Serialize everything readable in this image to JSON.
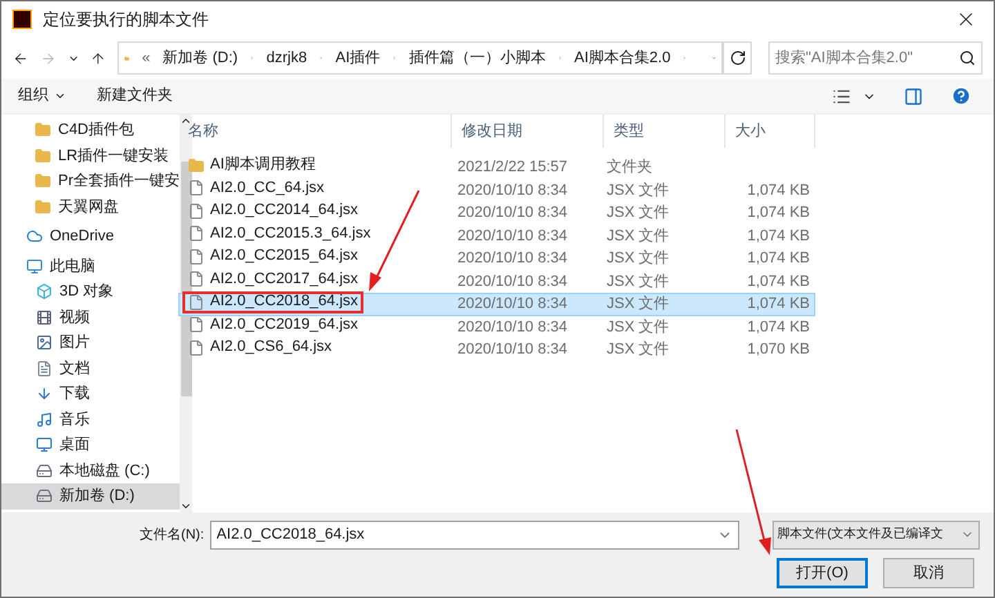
{
  "window": {
    "title": "定位要执行的脚本文件"
  },
  "address": {
    "overflow": "«",
    "path": [
      {
        "label": "新加卷 (D:)"
      },
      {
        "label": "dzrjk8"
      },
      {
        "label": "AI插件"
      },
      {
        "label": "插件篇（一）小脚本"
      },
      {
        "label": "AI脚本合集2.0"
      }
    ],
    "search_placeholder": "搜索\"AI脚本合集2.0\""
  },
  "toolbar": {
    "organize": "组织",
    "new_folder": "新建文件夹"
  },
  "sidebar": {
    "items": [
      {
        "label": "C4D插件包",
        "kind": "folder",
        "selected": false
      },
      {
        "label": "LR插件一键安装",
        "kind": "folder",
        "selected": false
      },
      {
        "label": "Pr全套插件一键安",
        "kind": "folder",
        "selected": false
      },
      {
        "label": "天翼网盘",
        "kind": "folder",
        "selected": false
      },
      {
        "label": "OneDrive",
        "kind": "cloud",
        "selected": false
      },
      {
        "label": "此电脑",
        "kind": "pc",
        "selected": false
      },
      {
        "label": "3D 对象",
        "kind": "cube",
        "selected": false
      },
      {
        "label": "视频",
        "kind": "video",
        "selected": false
      },
      {
        "label": "图片",
        "kind": "image",
        "selected": false
      },
      {
        "label": "文档",
        "kind": "doc",
        "selected": false
      },
      {
        "label": "下载",
        "kind": "download",
        "selected": false
      },
      {
        "label": "音乐",
        "kind": "music",
        "selected": false
      },
      {
        "label": "桌面",
        "kind": "desktop",
        "selected": false
      },
      {
        "label": "本地磁盘 (C:)",
        "kind": "drive",
        "selected": false
      },
      {
        "label": "新加卷 (D:)",
        "kind": "drive",
        "selected": true
      }
    ]
  },
  "table": {
    "columns": [
      "名称",
      "修改日期",
      "类型",
      "大小"
    ],
    "rows": [
      {
        "name": "AI脚本调用教程",
        "date": "2021/2/22 15:57",
        "type": "文件夹",
        "kind": "folder",
        "selected": false,
        "highlighted": false
      },
      {
        "name": "AI2.0_CC_64.jsx",
        "date": "2020/10/10 8:34",
        "type": "JSX 文件",
        "size": "1,074 KB",
        "kind": "file",
        "selected": false,
        "highlighted": false
      },
      {
        "name": "AI2.0_CC2014_64.jsx",
        "date": "2020/10/10 8:34",
        "type": "JSX 文件",
        "size": "1,074 KB",
        "kind": "file",
        "selected": false,
        "highlighted": false
      },
      {
        "name": "AI2.0_CC2015.3_64.jsx",
        "date": "2020/10/10 8:34",
        "type": "JSX 文件",
        "size": "1,074 KB",
        "kind": "file",
        "selected": false,
        "highlighted": false
      },
      {
        "name": "AI2.0_CC2015_64.jsx",
        "date": "2020/10/10 8:34",
        "type": "JSX 文件",
        "size": "1,074 KB",
        "kind": "file",
        "selected": false,
        "highlighted": false
      },
      {
        "name": "AI2.0_CC2017_64.jsx",
        "date": "2020/10/10 8:34",
        "type": "JSX 文件",
        "size": "1,074 KB",
        "kind": "file",
        "selected": false,
        "highlighted": false
      },
      {
        "name": "AI2.0_CC2018_64.jsx",
        "date": "2020/10/10 8:34",
        "type": "JSX 文件",
        "size": "1,074 KB",
        "kind": "file",
        "selected": true,
        "highlighted": true
      },
      {
        "name": "AI2.0_CC2019_64.jsx",
        "date": "2020/10/10 8:34",
        "type": "JSX 文件",
        "size": "1,074 KB",
        "kind": "file",
        "selected": false,
        "highlighted": false
      },
      {
        "name": "AI2.0_CS6_64.jsx",
        "date": "2020/10/10 8:34",
        "type": "JSX 文件",
        "size": "1,070 KB",
        "kind": "file",
        "selected": false,
        "highlighted": false
      }
    ]
  },
  "footer": {
    "filename_label": "文件名(N):",
    "filename": "AI2.0_CC2018_64.jsx",
    "filter": "脚本文件(文本文件及已编译文",
    "open": "打开(O)",
    "cancel": "取消"
  }
}
